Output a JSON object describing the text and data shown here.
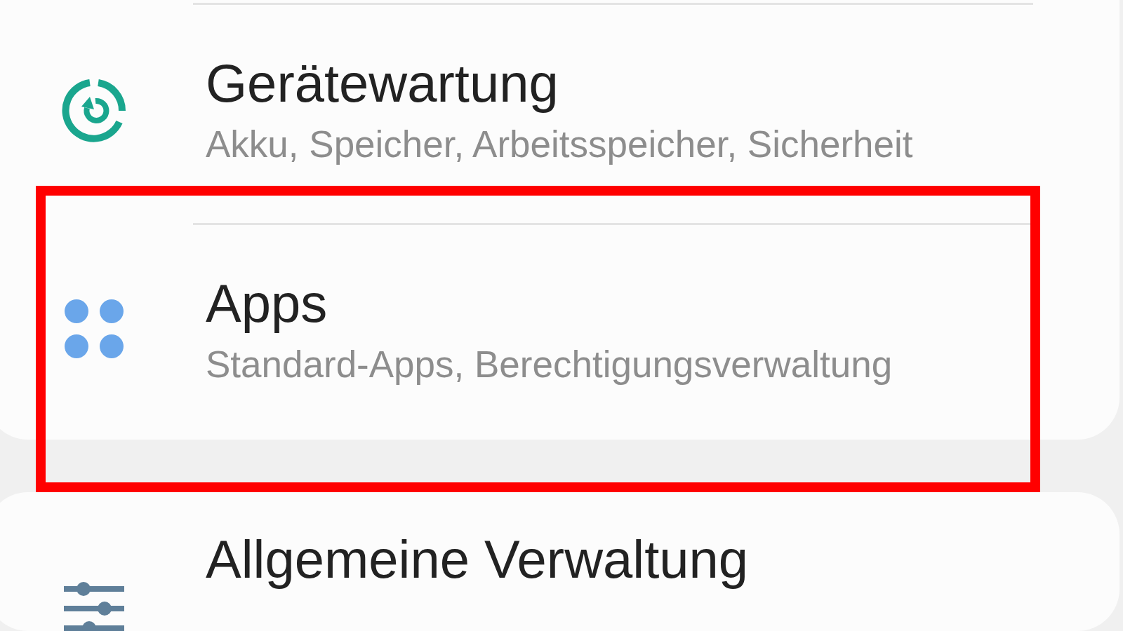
{
  "groups": [
    {
      "items": [
        {
          "kind": "maintenance",
          "title": "Gerätewartung",
          "subtitle": "Akku, Speicher, Arbeitsspeicher, Sicherheit",
          "highlighted": false
        },
        {
          "kind": "apps",
          "title": "Apps",
          "subtitle": "Standard-Apps, Berechtigungsverwaltung",
          "highlighted": true
        }
      ]
    },
    {
      "items": [
        {
          "kind": "sliders",
          "title": "Allgemeine Verwaltung",
          "highlighted": false
        }
      ]
    }
  ]
}
